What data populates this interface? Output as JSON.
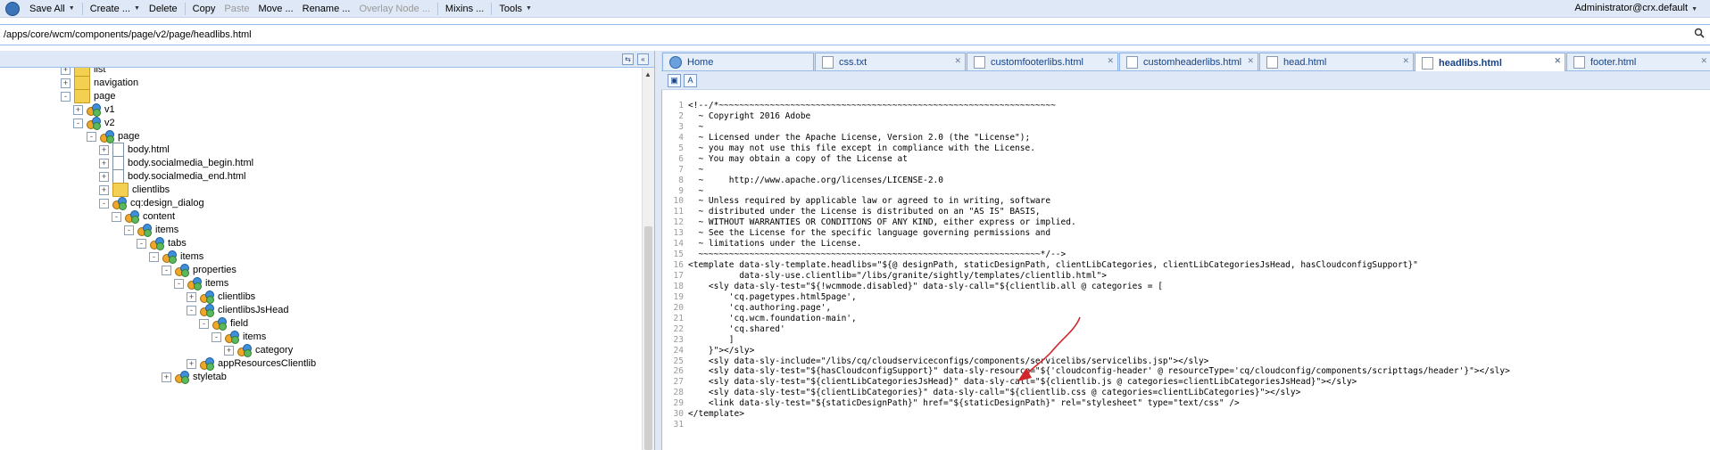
{
  "toolbar": {
    "items": [
      {
        "label": "Save All",
        "dropdown": true,
        "disabled": false
      },
      {
        "label": "Create ...",
        "dropdown": true,
        "disabled": false
      },
      {
        "label": "Delete",
        "dropdown": false,
        "disabled": false
      },
      {
        "label": "Copy",
        "dropdown": false,
        "disabled": false
      },
      {
        "label": "Paste",
        "dropdown": false,
        "disabled": true
      },
      {
        "label": "Move ...",
        "dropdown": false,
        "disabled": false
      },
      {
        "label": "Rename ...",
        "dropdown": false,
        "disabled": false
      },
      {
        "label": "Overlay Node ...",
        "dropdown": false,
        "disabled": true
      },
      {
        "label": "Mixins ...",
        "dropdown": false,
        "disabled": false
      },
      {
        "label": "Tools",
        "dropdown": true,
        "disabled": false
      }
    ],
    "user": "Administrator@crx.default"
  },
  "path": {
    "value": "/apps/core/wcm/components/page/v2/page/headlibs.html"
  },
  "tree": {
    "nodes": [
      {
        "label": "list",
        "icon": "folder-icon",
        "expander": "+"
      },
      {
        "label": "navigation",
        "icon": "folder-icon",
        "expander": "+"
      },
      {
        "label": "page",
        "icon": "folder-icon",
        "expander": "-"
      },
      {
        "label": "v1",
        "icon": "component-icon",
        "expander": "+"
      },
      {
        "label": "v2",
        "icon": "component-icon",
        "expander": "-"
      },
      {
        "label": "page",
        "icon": "component-icon",
        "expander": "-"
      },
      {
        "label": "body.html",
        "icon": "file-icon",
        "expander": "+"
      },
      {
        "label": "body.socialmedia_begin.html",
        "icon": "file-icon",
        "expander": "+"
      },
      {
        "label": "body.socialmedia_end.html",
        "icon": "file-icon",
        "expander": "+"
      },
      {
        "label": "clientlibs",
        "icon": "folder-icon",
        "expander": "+"
      },
      {
        "label": "cq:design_dialog",
        "icon": "component-icon",
        "expander": "-"
      },
      {
        "label": "content",
        "icon": "component-icon",
        "expander": "-"
      },
      {
        "label": "items",
        "icon": "component-icon",
        "expander": "-"
      },
      {
        "label": "tabs",
        "icon": "component-icon",
        "expander": "-"
      },
      {
        "label": "items",
        "icon": "component-icon",
        "expander": "-"
      },
      {
        "label": "properties",
        "icon": "component-icon",
        "expander": "-"
      },
      {
        "label": "items",
        "icon": "component-icon",
        "expander": "-"
      },
      {
        "label": "clientlibs",
        "icon": "component-icon",
        "expander": "+"
      },
      {
        "label": "clientlibsJsHead",
        "icon": "component-icon",
        "expander": "-"
      },
      {
        "label": "field",
        "icon": "component-icon",
        "expander": "-"
      },
      {
        "label": "items",
        "icon": "component-icon",
        "expander": "-"
      },
      {
        "label": "category",
        "icon": "component-icon",
        "expander": "+"
      },
      {
        "label": "appResourcesClientlib",
        "icon": "component-icon",
        "expander": "+"
      },
      {
        "label": "styletab",
        "icon": "component-icon",
        "expander": "+"
      }
    ]
  },
  "tabs": [
    {
      "label": "Home",
      "icon": "home-icon",
      "active": false
    },
    {
      "label": "css.txt",
      "icon": "file-icon",
      "active": false
    },
    {
      "label": "customfooterlibs.html",
      "icon": "file-icon",
      "active": false
    },
    {
      "label": "customheaderlibs.html",
      "icon": "file-icon",
      "active": false
    },
    {
      "label": "head.html",
      "icon": "file-icon",
      "active": false
    },
    {
      "label": "headlibs.html",
      "icon": "file-icon",
      "active": true
    },
    {
      "label": "footer.html",
      "icon": "file-icon",
      "active": false
    }
  ],
  "code": {
    "lines": [
      "<!--/*~~~~~~~~~~~~~~~~~~~~~~~~~~~~~~~~~~~~~~~~~~~~~~~~~~~~~~~~~~~~~~~~~~",
      "  ~ Copyright 2016 Adobe",
      "  ~",
      "  ~ Licensed under the Apache License, Version 2.0 (the \"License\");",
      "  ~ you may not use this file except in compliance with the License.",
      "  ~ You may obtain a copy of the License at",
      "  ~",
      "  ~     http://www.apache.org/licenses/LICENSE-2.0",
      "  ~",
      "  ~ Unless required by applicable law or agreed to in writing, software",
      "  ~ distributed under the License is distributed on an \"AS IS\" BASIS,",
      "  ~ WITHOUT WARRANTIES OR CONDITIONS OF ANY KIND, either express or implied.",
      "  ~ See the License for the specific language governing permissions and",
      "  ~ limitations under the License.",
      "  ~~~~~~~~~~~~~~~~~~~~~~~~~~~~~~~~~~~~~~~~~~~~~~~~~~~~~~~~~~~~~~~~~~~*/-->",
      "<template data-sly-template.headlibs=\"${@ designPath, staticDesignPath, clientLibCategories, clientLibCategoriesJsHead, hasCloudconfigSupport}\"",
      "          data-sly-use.clientlib=\"/libs/granite/sightly/templates/clientlib.html\">",
      "    <sly data-sly-test=\"${!wcmmode.disabled}\" data-sly-call=\"${clientlib.all @ categories = [",
      "        'cq.pagetypes.html5page',",
      "        'cq.authoring.page',",
      "        'cq.wcm.foundation-main',",
      "        'cq.shared'",
      "        ]",
      "    }\"></sly>",
      "    <sly data-sly-include=\"/libs/cq/cloudserviceconfigs/components/servicelibs/servicelibs.jsp\"></sly>",
      "    <sly data-sly-test=\"${hasCloudconfigSupport}\" data-sly-resource=\"${'cloudconfig-header' @ resourceType='cq/cloudconfig/components/scripttags/header'}\"></sly>",
      "    <sly data-sly-test=\"${clientLibCategoriesJsHead}\" data-sly-call=\"${clientlib.js @ categories=clientLibCategoriesJsHead}\"></sly>",
      "    <sly data-sly-test=\"${clientLibCategories}\" data-sly-call=\"${clientlib.css @ categories=clientLibCategories}\"></sly>",
      "    <link data-sly-test=\"${staticDesignPath}\" href=\"${staticDesignPath}\" rel=\"stylesheet\" type=\"text/css\" />",
      "</template>",
      ""
    ]
  },
  "colors": {
    "toolbar_bg": "#dfe8f6",
    "tab_bg": "#cedff5",
    "annotation_arrow": "#d0262b"
  }
}
